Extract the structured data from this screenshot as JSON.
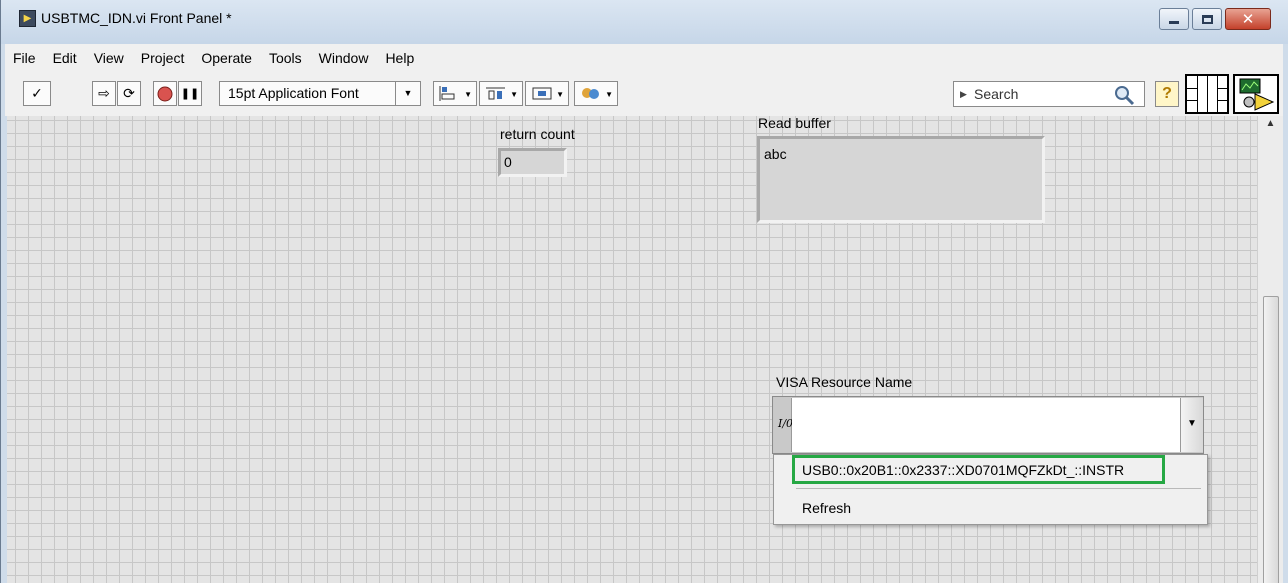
{
  "window": {
    "title": "USBTMC_IDN.vi Front Panel *",
    "app_icon_glyph": "▶",
    "close_glyph": "✕"
  },
  "menu": [
    "File",
    "Edit",
    "View",
    "Project",
    "Operate",
    "Tools",
    "Window",
    "Help"
  ],
  "toolbar": {
    "check_glyph": "✓",
    "run_glyph": "⇨",
    "run_continuously_glyph": "⟳",
    "pause_glyph": "❚❚",
    "font_label": "15pt Application Font",
    "search_placeholder": "Search",
    "help_glyph": "?"
  },
  "panel": {
    "return_count_label": "return count",
    "return_count_value": "0",
    "read_buffer_label": "Read buffer",
    "read_buffer_value": "abc",
    "visa_label": "VISA Resource Name",
    "visa_io_glyph": "I/0",
    "visa_value": "",
    "dropdown_options": [
      "USB0::0x20B1::0x2337::XD0701MQFZkDt_::INSTR",
      "Refresh"
    ]
  },
  "colors": {
    "highlight": "#26a844",
    "panel_bg": "#e4e4e4",
    "grid": "#c7c7c7"
  }
}
